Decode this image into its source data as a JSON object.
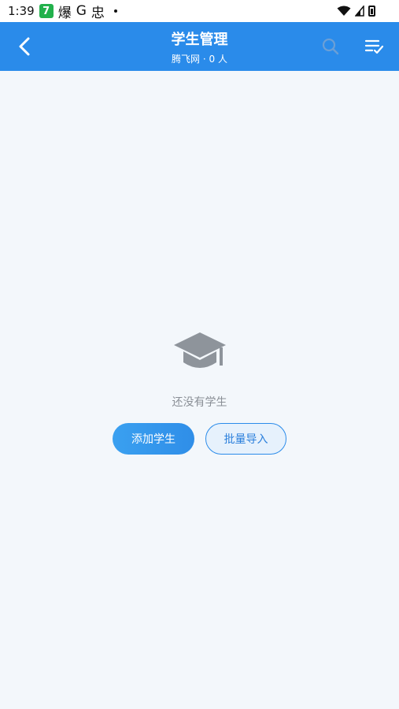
{
  "status_bar": {
    "time": "1:39",
    "app_badge": "7",
    "glyph_1": "爆",
    "glyph_2": "G",
    "glyph_3": "忠"
  },
  "header": {
    "title": "学生管理",
    "subtitle": "腾飞网 · 0 人",
    "accent_color": "#2a8bea"
  },
  "empty_state": {
    "icon": "graduation-cap-icon",
    "message": "还没有学生"
  },
  "actions": {
    "add_label": "添加学生",
    "import_label": "批量导入"
  }
}
